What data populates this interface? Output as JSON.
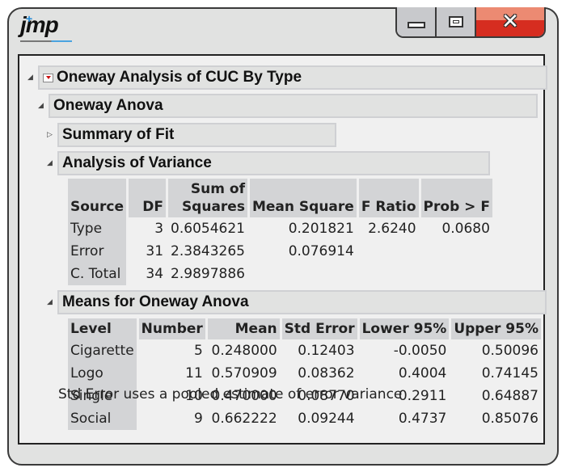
{
  "window": {
    "logo_text": "jmp",
    "controls": {
      "minimize": "minimize",
      "maximize": "maximize",
      "close": "close"
    },
    "close_color": "#d62d20"
  },
  "report": {
    "title": "Oneway Analysis of CUC By Type",
    "sections": {
      "oneway_anova": "Oneway Anova",
      "summary_of_fit": "Summary of Fit",
      "analysis_of_variance": "Analysis of Variance",
      "means": "Means for Oneway Anova"
    },
    "anova": {
      "headers": [
        "Source",
        "DF",
        "Sum of Squares",
        "Mean Square",
        "F Ratio",
        "Prob > F"
      ],
      "header_sum_line1": "Sum of",
      "header_sum_line2": "Squares",
      "rows": [
        {
          "source": "Type",
          "df": "3",
          "ss": "0.6054621",
          "ms": "0.201821",
          "f": "2.6240",
          "p": "0.0680"
        },
        {
          "source": "Error",
          "df": "31",
          "ss": "2.3843265",
          "ms": "0.076914",
          "f": "",
          "p": ""
        },
        {
          "source": "C. Total",
          "df": "34",
          "ss": "2.9897886",
          "ms": "",
          "f": "",
          "p": ""
        }
      ]
    },
    "means": {
      "headers": [
        "Level",
        "Number",
        "Mean",
        "Std Error",
        "Lower 95%",
        "Upper 95%"
      ],
      "rows": [
        {
          "level": "Cigarette",
          "n": "5",
          "mean": "0.248000",
          "se": "0.12403",
          "lo": "-0.0050",
          "hi": "0.50096"
        },
        {
          "level": "Logo",
          "n": "11",
          "mean": "0.570909",
          "se": "0.08362",
          "lo": "0.4004",
          "hi": "0.74145"
        },
        {
          "level": "Single",
          "n": "10",
          "mean": "0.470000",
          "se": "0.08770",
          "lo": "0.2911",
          "hi": "0.64887"
        },
        {
          "level": "Social",
          "n": "9",
          "mean": "0.662222",
          "se": "0.09244",
          "lo": "0.4737",
          "hi": "0.85076"
        }
      ],
      "note": "Std Error uses a pooled estimate of error variance"
    }
  }
}
